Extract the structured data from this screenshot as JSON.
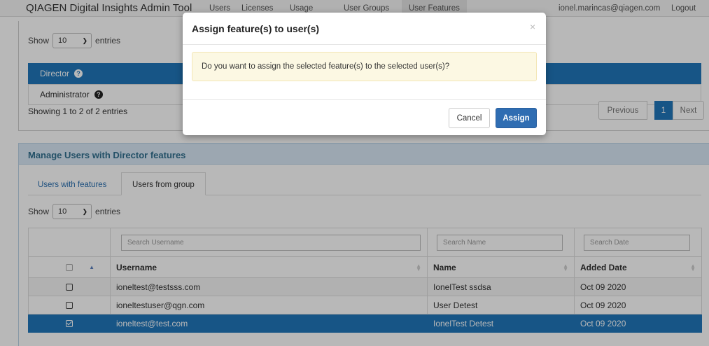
{
  "navbar": {
    "brand": "QIAGEN Digital Insights Admin Tool",
    "tabs": [
      {
        "label": "Users",
        "active": false
      },
      {
        "label": "Licenses",
        "active": false
      },
      {
        "label": "Usage",
        "active": false
      },
      {
        "label": "User Groups",
        "active": false
      },
      {
        "label": "User Features",
        "active": true
      }
    ],
    "user_email": "ionel.marincas@qiagen.com",
    "logout_label": "Logout"
  },
  "features_panel": {
    "length": {
      "show_label": "Show",
      "value": "10",
      "entries_label": "entries"
    },
    "rows": [
      {
        "label": "Director",
        "selected": true
      },
      {
        "label": "Administrator",
        "selected": false
      }
    ],
    "help_glyph": "?",
    "info": "Showing 1 to 2 of 2 entries",
    "pagination": {
      "previous": "Previous",
      "page": "1",
      "next": "Next"
    }
  },
  "manage_panel": {
    "heading": "Manage Users with Director features",
    "tabs": [
      {
        "label": "Users with features",
        "active": false
      },
      {
        "label": "Users from group",
        "active": true
      }
    ],
    "length": {
      "show_label": "Show",
      "value": "10",
      "entries_label": "entries"
    },
    "table": {
      "search_placeholders": {
        "username": "Search Username",
        "name": "Search Name",
        "date": "Search Date"
      },
      "columns": [
        "Username",
        "Name",
        "Added Date"
      ],
      "rows": [
        {
          "username": "ioneltest@testsss.com",
          "name": "IonelTest ssdsa",
          "date": "Oct 09 2020",
          "checked": false
        },
        {
          "username": "ioneltestuser@qgn.com",
          "name": "User Detest",
          "date": "Oct 09 2020",
          "checked": false
        },
        {
          "username": "ioneltest@test.com",
          "name": "IonelTest Detest",
          "date": "Oct 09 2020",
          "checked": true
        }
      ]
    }
  },
  "modal": {
    "title": "Assign feature(s) to user(s)",
    "close_glyph": "×",
    "message": "Do you want to assign the selected feature(s) to the selected user(s)?",
    "cancel_label": "Cancel",
    "assign_label": "Assign"
  },
  "colors": {
    "primary": "#2176ba",
    "alert_bg": "#fcf8e3",
    "heading_bg": "#d9e8f5"
  }
}
